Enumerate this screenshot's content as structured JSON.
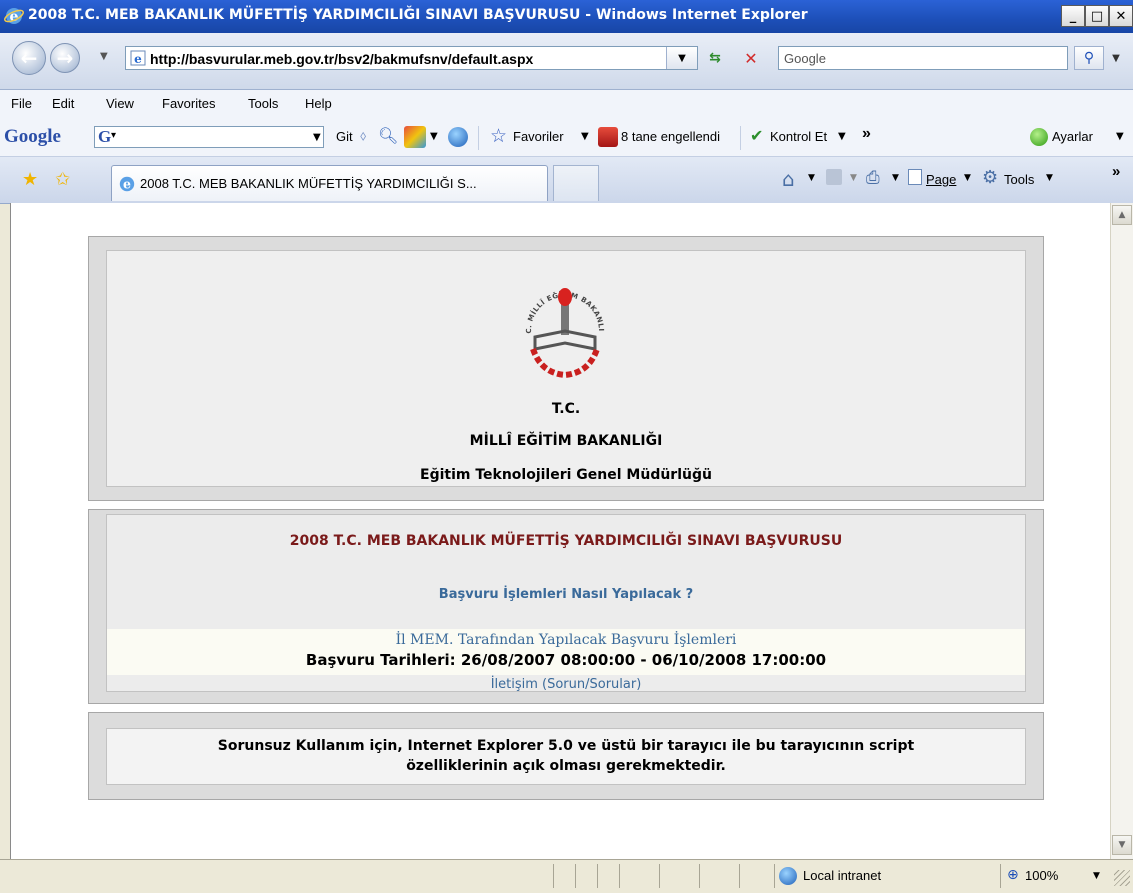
{
  "window": {
    "title": "2008 T.C. MEB BAKANLIK MÜFETTİŞ YARDIMCILIĞI SINAVI BAŞVURUSU - Windows Internet Explorer"
  },
  "address": {
    "url": "http://basvurular.meb.gov.tr/bsv2/bakmufsnv/default.aspx",
    "search_placeholder": "Google"
  },
  "menu": [
    "File",
    "Edit",
    "View",
    "Favorites",
    "Tools",
    "Help"
  ],
  "google_toolbar": {
    "logo": "Google",
    "go": "Git",
    "favorites": "Favoriler",
    "blocked": "8 tane engellendi",
    "spell": "Kontrol Et",
    "more": "»",
    "settings": "Ayarlar"
  },
  "tabs": {
    "active_label": "2008 T.C. MEB BAKANLIK MÜFETTİŞ YARDIMCILIĞI S...",
    "page_label": "Page",
    "tools_label": "Tools",
    "more": "»"
  },
  "page": {
    "header": {
      "seal_text": "T.C. MİLLÎ EĞİTİM BAKANLIĞI",
      "line1": "T.C.",
      "line2": "MİLLÎ EĞİTİM BAKANLIĞI",
      "line3": "Eğitim Teknolojileri Genel Müdürlüğü"
    },
    "main": {
      "title": "2008 T.C. MEB BAKANLIK MÜFETTİŞ YARDIMCILIĞI SINAVI BAŞVURUSU",
      "howto_link": "Başvuru İşlemleri Nasıl Yapılacak ?",
      "ilmem_link": "İl MEM. Tarafından Yapılacak Başvuru İşlemleri",
      "dates": "Başvuru Tarihleri: 26/08/2007 08:00:00 - 06/10/2008 17:00:00",
      "contact_link": "İletişim (Sorun/Sorular)"
    },
    "notice": {
      "line1": "Sorunsuz Kullanım için, Internet Explorer 5.0 ve üstü bir tarayıcı ile bu tarayıcının script",
      "line2": "özelliklerinin açık olması gerekmektedir."
    }
  },
  "status": {
    "zone": "Local intranet",
    "zoom": "100%"
  },
  "colors": {
    "titlebar": "#1d4fb8",
    "maroon_title": "#7a1a1a",
    "link_blue": "#3a6a9a"
  }
}
